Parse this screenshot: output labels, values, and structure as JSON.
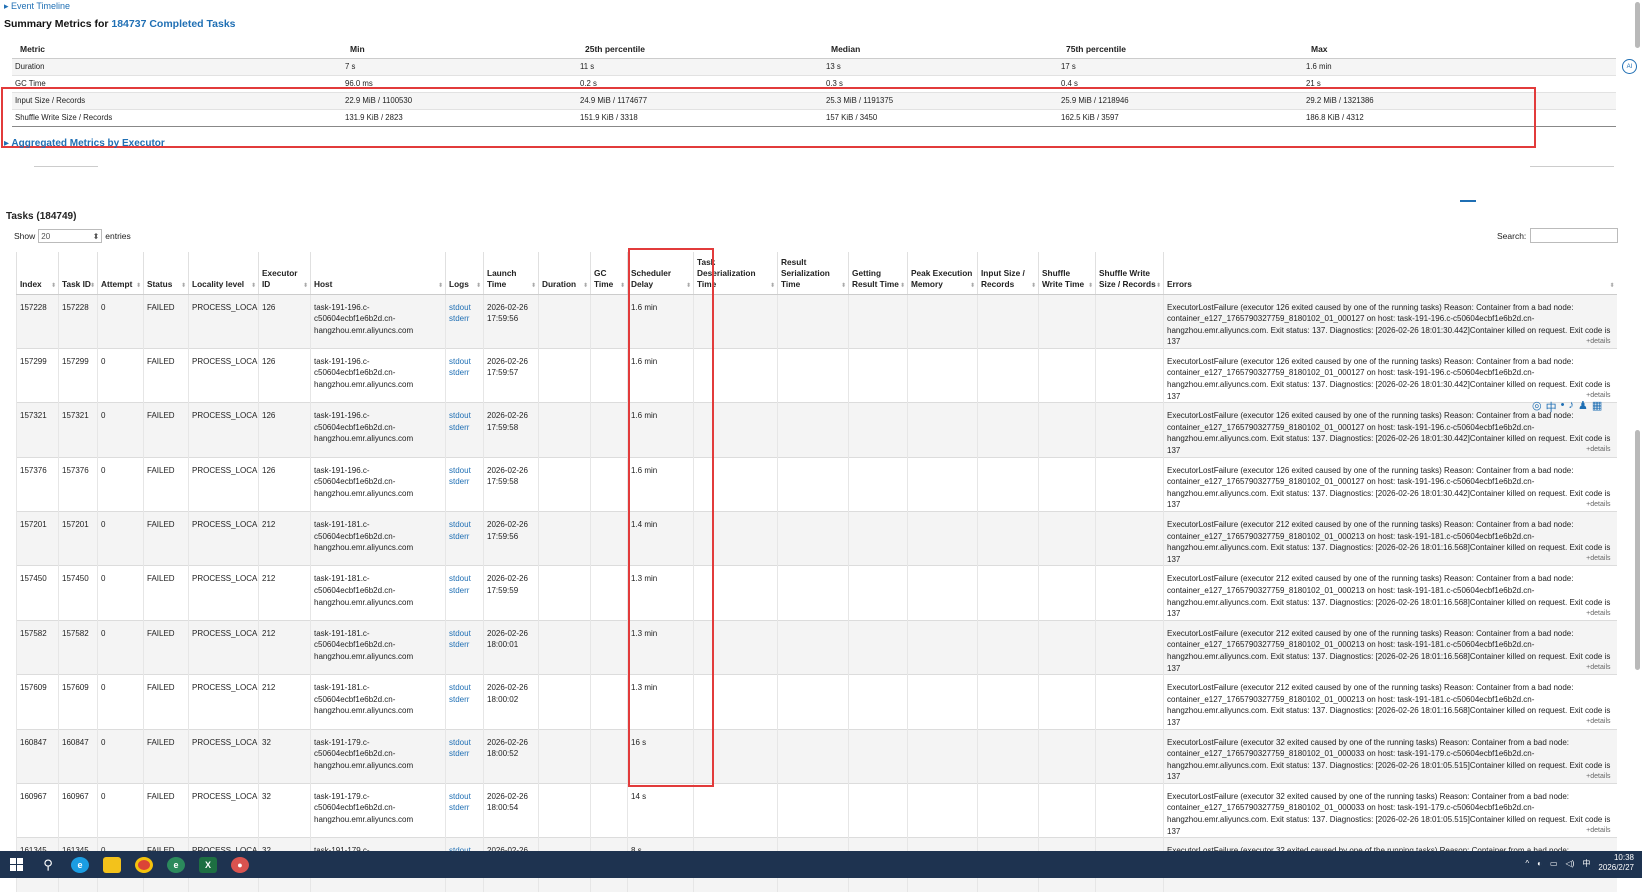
{
  "header": {
    "event_timeline": "▸ Event Timeline",
    "summary_prefix": "Summary Metrics for ",
    "summary_link": "184737 Completed Tasks"
  },
  "summary": {
    "columns": [
      "Metric",
      "Min",
      "25th percentile",
      "Median",
      "75th percentile",
      "Max"
    ],
    "rows": [
      [
        "Duration",
        "7 s",
        "11 s",
        "13 s",
        "17 s",
        "1.6 min"
      ],
      [
        "GC Time",
        "96.0 ms",
        "0.2 s",
        "0.3 s",
        "0.4 s",
        "21 s"
      ],
      [
        "Input Size / Records",
        "22.9 MiB / 1100530",
        "24.9 MiB / 1174677",
        "25.3 MiB / 1191375",
        "25.9 MiB / 1218946",
        "29.2 MiB / 1321386"
      ],
      [
        "Shuffle Write Size / Records",
        "131.9 KiB / 2823",
        "151.9 KiB / 3318",
        "157 KiB / 3450",
        "162.5 KiB / 3597",
        "186.8 KiB / 4312"
      ]
    ]
  },
  "aggregated_link": "▸ Aggregated Metrics by Executor",
  "tasks": {
    "title": "Tasks (184749)",
    "show_label": "Show",
    "show_value": "20",
    "entries_label": "entries",
    "search_label": "Search:",
    "columns": [
      "Index",
      "Task ID",
      "Attempt",
      "Status",
      "Locality level",
      "Executor ID",
      "Host",
      "Logs",
      "Launch Time",
      "Duration",
      "GC Time",
      "Scheduler Delay",
      "Task Deserialization Time",
      "Result Serialization Time",
      "Getting Result Time",
      "Peak Execution Memory",
      "Input Size / Records",
      "Shuffle Write Time",
      "Shuffle Write Size / Records",
      "Errors"
    ],
    "log_labels": [
      "stdout",
      "stderr"
    ],
    "details_label": "+details",
    "rows": [
      {
        "index": "157228",
        "task_id": "157228",
        "attempt": "0",
        "status": "FAILED",
        "locality": "PROCESS_LOCAL",
        "executor": "126",
        "host": "task-191-196.c-c50604ecbf1e6b2d.cn-hangzhou.emr.aliyuncs.com",
        "launch": "2026-02-26 17:59:56",
        "delay": "1.6 min",
        "error": "ExecutorLostFailure (executor 126 exited caused by one of the running tasks) Reason: Container from a bad node: container_e127_1765790327759_8180102_01_000127 on host: task-191-196.c-c50604ecbf1e6b2d.cn-hangzhou.emr.aliyuncs.com. Exit status: 137. Diagnostics: [2026-02-26 18:01:30.442]Container killed on request. Exit code is 137"
      },
      {
        "index": "157299",
        "task_id": "157299",
        "attempt": "0",
        "status": "FAILED",
        "locality": "PROCESS_LOCAL",
        "executor": "126",
        "host": "task-191-196.c-c50604ecbf1e6b2d.cn-hangzhou.emr.aliyuncs.com",
        "launch": "2026-02-26 17:59:57",
        "delay": "1.6 min",
        "error": "ExecutorLostFailure (executor 126 exited caused by one of the running tasks) Reason: Container from a bad node: container_e127_1765790327759_8180102_01_000127 on host: task-191-196.c-c50604ecbf1e6b2d.cn-hangzhou.emr.aliyuncs.com. Exit status: 137. Diagnostics: [2026-02-26 18:01:30.442]Container killed on request. Exit code is 137"
      },
      {
        "index": "157321",
        "task_id": "157321",
        "attempt": "0",
        "status": "FAILED",
        "locality": "PROCESS_LOCAL",
        "executor": "126",
        "host": "task-191-196.c-c50604ecbf1e6b2d.cn-hangzhou.emr.aliyuncs.com",
        "launch": "2026-02-26 17:59:58",
        "delay": "1.6 min",
        "error": "ExecutorLostFailure (executor 126 exited caused by one of the running tasks) Reason: Container from a bad node: container_e127_1765790327759_8180102_01_000127 on host: task-191-196.c-c50604ecbf1e6b2d.cn-hangzhou.emr.aliyuncs.com. Exit status: 137. Diagnostics: [2026-02-26 18:01:30.442]Container killed on request. Exit code is 137"
      },
      {
        "index": "157376",
        "task_id": "157376",
        "attempt": "0",
        "status": "FAILED",
        "locality": "PROCESS_LOCAL",
        "executor": "126",
        "host": "task-191-196.c-c50604ecbf1e6b2d.cn-hangzhou.emr.aliyuncs.com",
        "launch": "2026-02-26 17:59:58",
        "delay": "1.6 min",
        "error": "ExecutorLostFailure (executor 126 exited caused by one of the running tasks) Reason: Container from a bad node: container_e127_1765790327759_8180102_01_000127 on host: task-191-196.c-c50604ecbf1e6b2d.cn-hangzhou.emr.aliyuncs.com. Exit status: 137. Diagnostics: [2026-02-26 18:01:30.442]Container killed on request. Exit code is 137"
      },
      {
        "index": "157201",
        "task_id": "157201",
        "attempt": "0",
        "status": "FAILED",
        "locality": "PROCESS_LOCAL",
        "executor": "212",
        "host": "task-191-181.c-c50604ecbf1e6b2d.cn-hangzhou.emr.aliyuncs.com",
        "launch": "2026-02-26 17:59:56",
        "delay": "1.4 min",
        "error": "ExecutorLostFailure (executor 212 exited caused by one of the running tasks) Reason: Container from a bad node: container_e127_1765790327759_8180102_01_000213 on host: task-191-181.c-c50604ecbf1e6b2d.cn-hangzhou.emr.aliyuncs.com. Exit status: 137. Diagnostics: [2026-02-26 18:01:16.568]Container killed on request. Exit code is 137"
      },
      {
        "index": "157450",
        "task_id": "157450",
        "attempt": "0",
        "status": "FAILED",
        "locality": "PROCESS_LOCAL",
        "executor": "212",
        "host": "task-191-181.c-c50604ecbf1e6b2d.cn-hangzhou.emr.aliyuncs.com",
        "launch": "2026-02-26 17:59:59",
        "delay": "1.3 min",
        "error": "ExecutorLostFailure (executor 212 exited caused by one of the running tasks) Reason: Container from a bad node: container_e127_1765790327759_8180102_01_000213 on host: task-191-181.c-c50604ecbf1e6b2d.cn-hangzhou.emr.aliyuncs.com. Exit status: 137. Diagnostics: [2026-02-26 18:01:16.568]Container killed on request. Exit code is 137"
      },
      {
        "index": "157582",
        "task_id": "157582",
        "attempt": "0",
        "status": "FAILED",
        "locality": "PROCESS_LOCAL",
        "executor": "212",
        "host": "task-191-181.c-c50604ecbf1e6b2d.cn-hangzhou.emr.aliyuncs.com",
        "launch": "2026-02-26 18:00:01",
        "delay": "1.3 min",
        "error": "ExecutorLostFailure (executor 212 exited caused by one of the running tasks) Reason: Container from a bad node: container_e127_1765790327759_8180102_01_000213 on host: task-191-181.c-c50604ecbf1e6b2d.cn-hangzhou.emr.aliyuncs.com. Exit status: 137. Diagnostics: [2026-02-26 18:01:16.568]Container killed on request. Exit code is 137"
      },
      {
        "index": "157609",
        "task_id": "157609",
        "attempt": "0",
        "status": "FAILED",
        "locality": "PROCESS_LOCAL",
        "executor": "212",
        "host": "task-191-181.c-c50604ecbf1e6b2d.cn-hangzhou.emr.aliyuncs.com",
        "launch": "2026-02-26 18:00:02",
        "delay": "1.3 min",
        "error": "ExecutorLostFailure (executor 212 exited caused by one of the running tasks) Reason: Container from a bad node: container_e127_1765790327759_8180102_01_000213 on host: task-191-181.c-c50604ecbf1e6b2d.cn-hangzhou.emr.aliyuncs.com. Exit status: 137. Diagnostics: [2026-02-26 18:01:16.568]Container killed on request. Exit code is 137"
      },
      {
        "index": "160847",
        "task_id": "160847",
        "attempt": "0",
        "status": "FAILED",
        "locality": "PROCESS_LOCAL",
        "executor": "32",
        "host": "task-191-179.c-c50604ecbf1e6b2d.cn-hangzhou.emr.aliyuncs.com",
        "launch": "2026-02-26 18:00:52",
        "delay": "16 s",
        "error": "ExecutorLostFailure (executor 32 exited caused by one of the running tasks) Reason: Container from a bad node: container_e127_1765790327759_8180102_01_000033 on host: task-191-179.c-c50604ecbf1e6b2d.cn-hangzhou.emr.aliyuncs.com. Exit status: 137. Diagnostics: [2026-02-26 18:01:05.515]Container killed on request. Exit code is 137"
      },
      {
        "index": "160967",
        "task_id": "160967",
        "attempt": "0",
        "status": "FAILED",
        "locality": "PROCESS_LOCAL",
        "executor": "32",
        "host": "task-191-179.c-c50604ecbf1e6b2d.cn-hangzhou.emr.aliyuncs.com",
        "launch": "2026-02-26 18:00:54",
        "delay": "14 s",
        "error": "ExecutorLostFailure (executor 32 exited caused by one of the running tasks) Reason: Container from a bad node: container_e127_1765790327759_8180102_01_000033 on host: task-191-179.c-c50604ecbf1e6b2d.cn-hangzhou.emr.aliyuncs.com. Exit status: 137. Diagnostics: [2026-02-26 18:01:05.515]Container killed on request. Exit code is 137"
      },
      {
        "index": "161345",
        "task_id": "161345",
        "attempt": "0",
        "status": "FAILED",
        "locality": "PROCESS_LOCAL",
        "executor": "32",
        "host": "task-191-179.c-",
        "launch": "2026-02-26",
        "delay": "8 s",
        "error": "ExecutorLostFailure (executor 32 exited caused by one of the running tasks) Reason: Container from a bad node:"
      }
    ]
  },
  "taskbar": {
    "start_icon": "windows-start-icon",
    "time": "10:38",
    "date": "2026/2/27",
    "ime": "中"
  },
  "colors": {
    "link": "#1f6fb4",
    "highlight_box": "#e23b3b",
    "taskbar": "#1e3350"
  }
}
